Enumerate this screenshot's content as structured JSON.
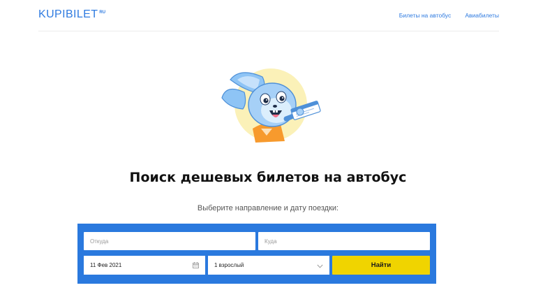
{
  "header": {
    "logo_text": "KUPIBILET",
    "logo_suffix": "RU",
    "nav": [
      {
        "label": "Билеты на автобус"
      },
      {
        "label": "Авиабилеты"
      }
    ]
  },
  "hero": {
    "icon": "rabbit-with-ticket-illustration"
  },
  "main": {
    "title": "Поиск дешевых билетов на автобус",
    "subtitle": "Выберите направление и дату поездки:"
  },
  "search": {
    "from_placeholder": "Откуда",
    "to_placeholder": "Куда",
    "date_value": "11 Фев 2021",
    "passengers_value": "1 взрослый",
    "submit_label": "Найти"
  },
  "colors": {
    "brand_blue": "#2a79de",
    "button_yellow": "#f0d400"
  }
}
